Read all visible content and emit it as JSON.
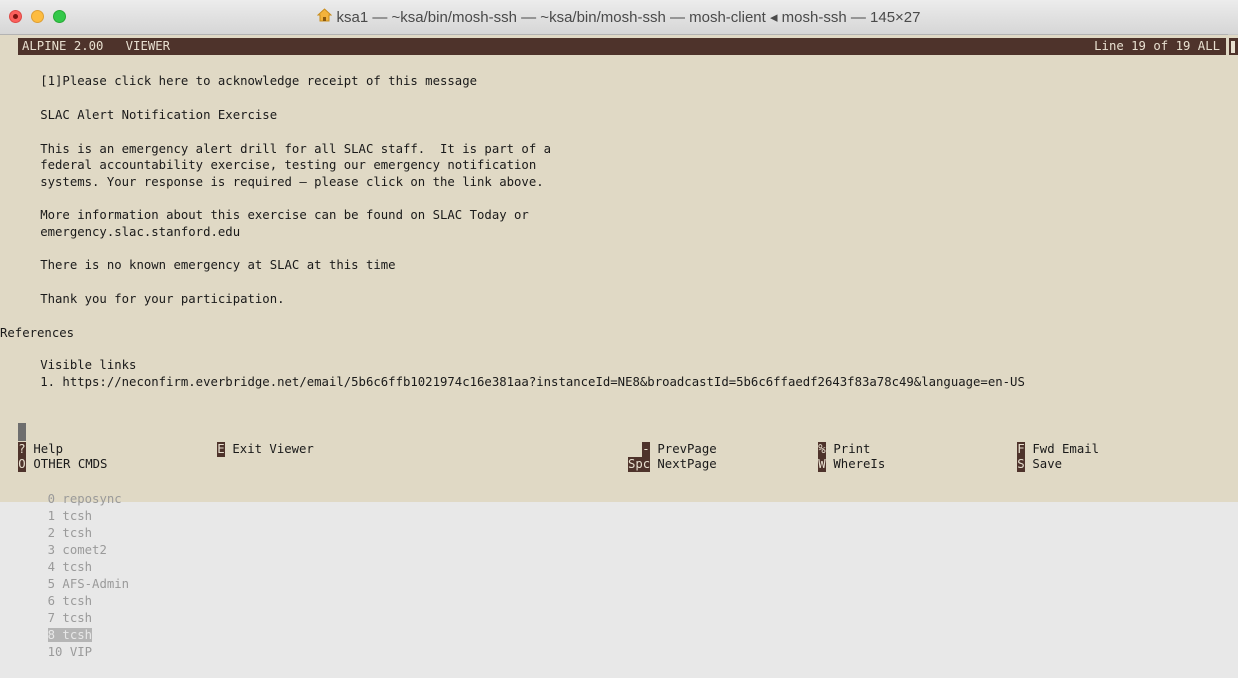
{
  "window": {
    "title": "ksa1 — ~ksa/bin/mosh-ssh — ~ksa/bin/mosh-ssh — mosh-client ◂ mosh-ssh — 145×27"
  },
  "header": {
    "app": "ALPINE 2.00   VIEWER",
    "position": "Line 19 of 19 ALL"
  },
  "body_lines": [
    "   [1]Please click here to acknowledge receipt of this message",
    "   SLAC Alert Notification Exercise",
    "   This is an emergency alert drill for all SLAC staff.  It is part of a",
    "   federal accountability exercise, testing our emergency notification",
    "   systems. Your response is required – please click on the link above.",
    "   More information about this exercise can be found on SLAC Today or",
    "   emergency.slac.stanford.edu",
    "   There is no known emergency at SLAC at this time",
    "   Thank you for your participation.",
    "References",
    "   Visible links",
    "   1. https://neconfirm.everbridge.net/email/5b6c6ffb1021974c16e381aa?instanceId=NE8&broadcastId=5b6c6ffaedf2643f83a78c49&language=en-US"
  ],
  "commands": {
    "help": {
      "key": "?",
      "label": " Help"
    },
    "other": {
      "key": "O",
      "label": " OTHER CMDS"
    },
    "exit": {
      "key": "E",
      "label": " Exit Viewer"
    },
    "prevpage": {
      "key": "-",
      "label": " PrevPage"
    },
    "nextpage": {
      "key": "Spc",
      "label": " NextPage"
    },
    "print": {
      "key": "%",
      "label": " Print"
    },
    "whereis": {
      "key": "W",
      "label": " WhereIs"
    },
    "fwd": {
      "key": "F",
      "label": " Fwd Email"
    },
    "save": {
      "key": "S",
      "label": " Save"
    }
  },
  "tabs": [
    {
      "label": "0 reposync"
    },
    {
      "label": "1 tcsh"
    },
    {
      "label": "2 tcsh"
    },
    {
      "label": "3 comet2"
    },
    {
      "label": "4 tcsh"
    },
    {
      "label": "5 AFS-Admin"
    },
    {
      "label": "6 tcsh"
    },
    {
      "label": "7 tcsh"
    },
    {
      "label": "8 tcsh"
    },
    {
      "label": "10 VIP"
    }
  ],
  "colors": {
    "terminal_bg": "#e0d9c5",
    "header_bg": "#4e332b",
    "header_fg": "#e8e0d0"
  }
}
